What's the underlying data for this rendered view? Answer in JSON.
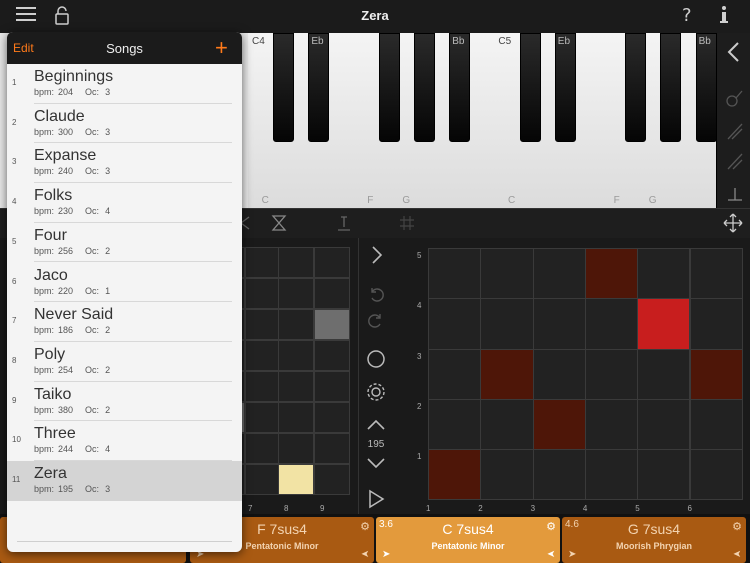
{
  "header": {
    "title": "Zera"
  },
  "keyboard": {
    "white_labels": [
      {
        "key": 0,
        "text": "C"
      },
      {
        "key": 3,
        "text": "F"
      },
      {
        "key": 4,
        "text": "G"
      },
      {
        "key": 7,
        "text": "C"
      },
      {
        "key": 10,
        "text": "F"
      },
      {
        "key": 11,
        "text": "G"
      }
    ],
    "top_labels": [
      {
        "white": 0,
        "text": "C4"
      },
      {
        "black": 1,
        "text": "Eb"
      },
      {
        "black": 4,
        "text": "Bb"
      },
      {
        "white": 7,
        "text": "C5"
      },
      {
        "black": 6,
        "text": "Eb"
      },
      {
        "black": 9,
        "text": "Bb"
      }
    ]
  },
  "songs_popover": {
    "edit_label": "Edit",
    "title": "Songs",
    "add_label": "+",
    "bpm_label": "bpm:",
    "oc_label": "Oc:",
    "selected_index": 10,
    "items": [
      {
        "num": "1",
        "title": "Beginnings",
        "bpm": "204",
        "oc": "3"
      },
      {
        "num": "2",
        "title": "Claude",
        "bpm": "300",
        "oc": "3"
      },
      {
        "num": "3",
        "title": "Expanse",
        "bpm": "240",
        "oc": "3"
      },
      {
        "num": "4",
        "title": "Folks",
        "bpm": "230",
        "oc": "4"
      },
      {
        "num": "5",
        "title": "Four",
        "bpm": "256",
        "oc": "2"
      },
      {
        "num": "6",
        "title": "Jaco",
        "bpm": "220",
        "oc": "1"
      },
      {
        "num": "7",
        "title": "Never Said",
        "bpm": "186",
        "oc": "2"
      },
      {
        "num": "8",
        "title": "Poly",
        "bpm": "254",
        "oc": "2"
      },
      {
        "num": "9",
        "title": "Taiko",
        "bpm": "380",
        "oc": "2"
      },
      {
        "num": "10",
        "title": "Three",
        "bpm": "244",
        "oc": "4"
      },
      {
        "num": "11",
        "title": "Zera",
        "bpm": "195",
        "oc": "3"
      }
    ]
  },
  "left_grid": {
    "col_labels": [
      "7",
      "8",
      "9"
    ],
    "colors": {
      "light_gray": "#8a8a8a",
      "gray": "#6e6e6e",
      "cream": "#f2e3a4"
    }
  },
  "controls": {
    "tempo": "195"
  },
  "right_grid": {
    "row_labels": [
      "5",
      "4",
      "3",
      "2",
      "1"
    ],
    "col_labels": [
      "1",
      "2",
      "3",
      "4",
      "5",
      "6"
    ],
    "colors": {
      "dark_red": "#4e1608",
      "bright_red": "#c81e1e"
    }
  },
  "chords": [
    {
      "pos": "",
      "name": "F 7sus4",
      "scale": "Pentatonic Minor",
      "active": false
    },
    {
      "pos": "3.6",
      "name": "C 7sus4",
      "scale": "Pentatonic Minor",
      "active": true
    },
    {
      "pos": "4.6",
      "name": "G 7sus4",
      "scale": "Moorish Phrygian",
      "active": false
    }
  ],
  "accent_color": "#ff7a1a"
}
